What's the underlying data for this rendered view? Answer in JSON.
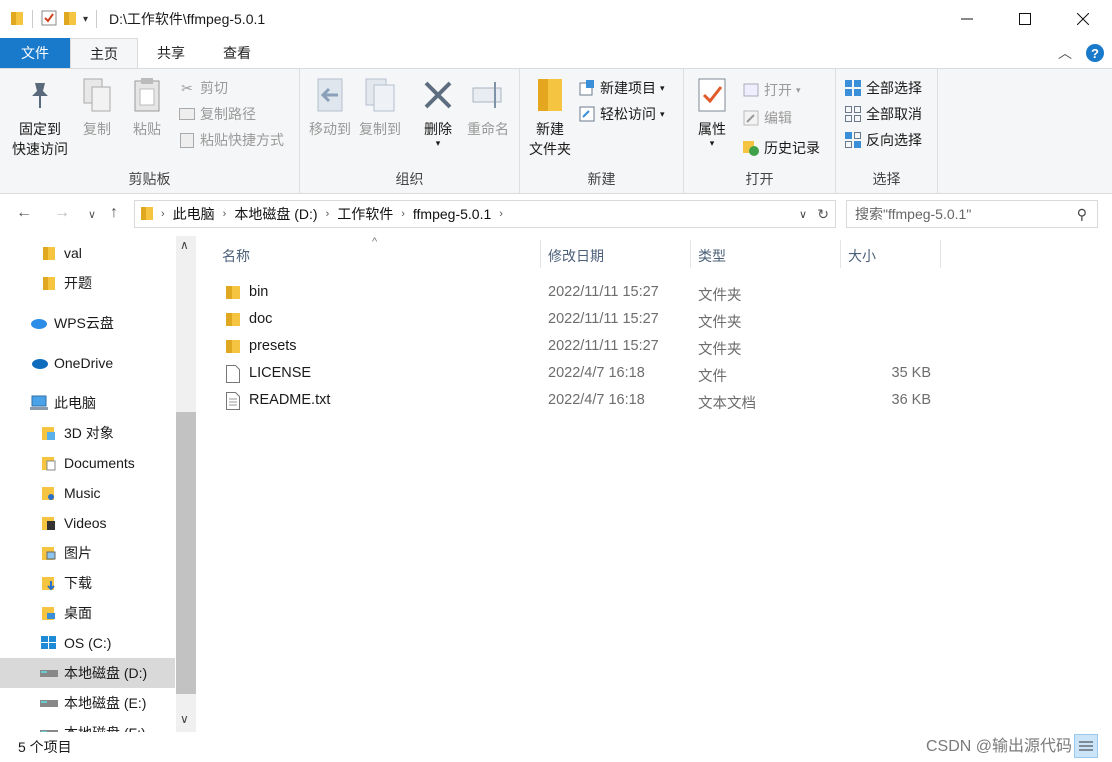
{
  "window": {
    "title": "D:\\工作软件\\ffmpeg-5.0.1"
  },
  "tabs": [
    "文件",
    "主页",
    "共享",
    "查看"
  ],
  "ribbon": {
    "clipboard": {
      "label": "剪贴板",
      "pin": "固定到\n快速访问",
      "copy": "复制",
      "paste": "粘贴",
      "cut": "剪切",
      "copy_path": "复制路径",
      "paste_shortcut": "粘贴快捷方式"
    },
    "organize": {
      "label": "组织",
      "move_to": "移动到",
      "copy_to": "复制到",
      "delete": "删除",
      "rename": "重命名"
    },
    "new": {
      "label": "新建",
      "new_folder": "新建\n文件夹",
      "new_item": "新建项目",
      "easy_access": "轻松访问"
    },
    "open": {
      "label": "打开",
      "properties": "属性",
      "open": "打开",
      "edit": "编辑",
      "history": "历史记录"
    },
    "select": {
      "label": "选择",
      "select_all": "全部选择",
      "select_none": "全部取消",
      "invert": "反向选择"
    }
  },
  "address": {
    "crumbs": [
      "此电脑",
      "本地磁盘 (D:)",
      "工作软件",
      "ffmpeg-5.0.1"
    ],
    "search_placeholder": "搜索\"ffmpeg-5.0.1\""
  },
  "nav": [
    {
      "label": "val",
      "icon": "folder-icon"
    },
    {
      "label": "开题",
      "icon": "folder-icon"
    },
    {
      "label": "WPS云盘",
      "icon": "cloud-icon"
    },
    {
      "label": "OneDrive",
      "icon": "onedrive-icon"
    },
    {
      "label": "此电脑",
      "icon": "computer-icon"
    },
    {
      "label": "3D 对象",
      "icon": "3d-objects-icon"
    },
    {
      "label": "Documents",
      "icon": "documents-icon"
    },
    {
      "label": "Music",
      "icon": "music-icon"
    },
    {
      "label": "Videos",
      "icon": "videos-icon"
    },
    {
      "label": "图片",
      "icon": "pictures-icon"
    },
    {
      "label": "下载",
      "icon": "downloads-icon"
    },
    {
      "label": "桌面",
      "icon": "desktop-icon"
    },
    {
      "label": "OS (C:)",
      "icon": "windows-drive-icon"
    },
    {
      "label": "本地磁盘 (D:)",
      "icon": "drive-icon"
    },
    {
      "label": "本地磁盘 (E:)",
      "icon": "drive-icon"
    },
    {
      "label": "本地磁盘 (F:)",
      "icon": "drive-icon"
    }
  ],
  "columns": {
    "name": "名称",
    "date": "修改日期",
    "type": "类型",
    "size": "大小"
  },
  "files": [
    {
      "name": "bin",
      "date": "2022/11/11 15:27",
      "type": "文件夹",
      "size": "",
      "icon": "folder-icon"
    },
    {
      "name": "doc",
      "date": "2022/11/11 15:27",
      "type": "文件夹",
      "size": "",
      "icon": "folder-icon"
    },
    {
      "name": "presets",
      "date": "2022/11/11 15:27",
      "type": "文件夹",
      "size": "",
      "icon": "folder-icon"
    },
    {
      "name": "LICENSE",
      "date": "2022/4/7 16:18",
      "type": "文件",
      "size": "35 KB",
      "icon": "file-icon"
    },
    {
      "name": "README.txt",
      "date": "2022/4/7 16:18",
      "type": "文本文档",
      "size": "36 KB",
      "icon": "text-file-icon"
    }
  ],
  "status": {
    "count": "5 个项目"
  },
  "watermark": "CSDN @输出源代码"
}
